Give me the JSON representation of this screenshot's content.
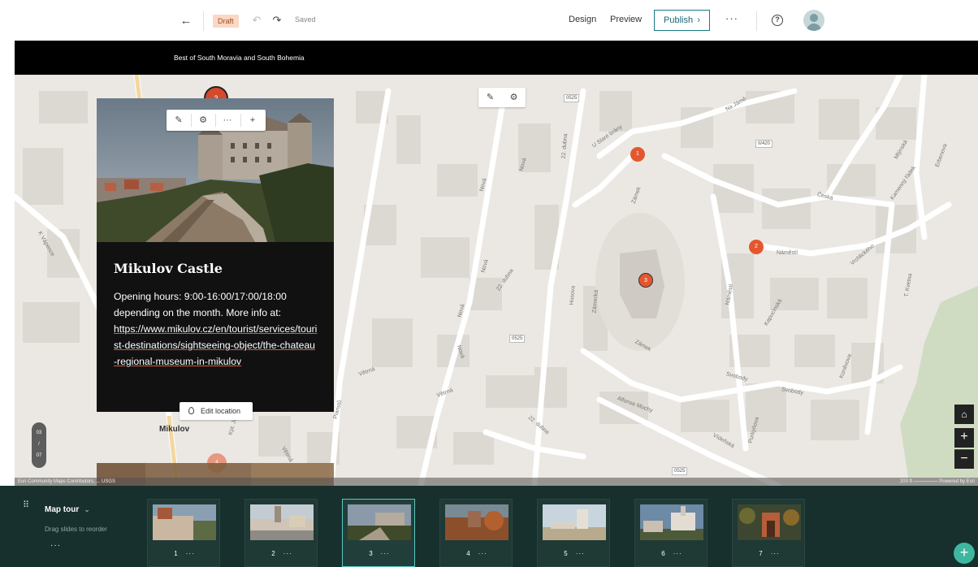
{
  "toolbar": {
    "back_icon": "arrow-left-icon",
    "draft_badge": "Draft",
    "saved_status": "Saved",
    "design_label": "Design",
    "preview_label": "Preview",
    "publish_label": "Publish",
    "more_label": "···",
    "help_icon": "question-circle-icon",
    "avatar_icon": "user-avatar-icon"
  },
  "story": {
    "title": "Best of South Moravia and South Bohemia"
  },
  "map": {
    "street_labels": [
      "Nová",
      "Nová",
      "Nová",
      "Nová",
      "Nová",
      "22. dubna",
      "22. dubna",
      "22. dubna",
      "U Staré brány",
      "Na Jámě",
      "Zámek",
      "Zámek",
      "Zámek",
      "Náměstí",
      "Náměstí",
      "Česká",
      "Vrchlického",
      "Mlýnská",
      "Erbenova",
      "Husova",
      "Zámecká",
      "Kapucínská",
      "Svobody",
      "Svobody",
      "Alfonse Muchy",
      "Vídeňská",
      "Purkyňova",
      "Koněvova",
      "T. Kvetna",
      "Větrná",
      "Větrná",
      "Větrná",
      "Piaristů",
      "K Vápence",
      "Kpt. Jaroše",
      "Kamenný řádek",
      "Brněnská",
      "Komenského",
      "Husova",
      "Ruská",
      "Kozí hrádek"
    ],
    "route_badges": [
      "0525",
      "II/420",
      "0525",
      "0525"
    ],
    "place_label": "Mikulov",
    "markers": [
      {
        "label": "1",
        "active": false
      },
      {
        "label": "2",
        "active": false
      },
      {
        "label": "3",
        "active": false
      },
      {
        "label": "3",
        "active": true
      },
      {
        "label": "4",
        "active": false
      }
    ],
    "map_tools": {
      "edit_icon": "pencil-icon",
      "settings_icon": "gear-icon"
    },
    "home_icon": "home-icon",
    "zoom_in": "+",
    "zoom_out": "−",
    "attribution_left": "Esri Community Maps Contributors, ... USGS",
    "attribution_right": "200 ft ⎯⎯⎯⎯⎯⎯⎯⎯⎯⎯ Powered by Esri",
    "slide_counter": {
      "current": "03",
      "sep": "/",
      "total": "07"
    }
  },
  "card": {
    "toolbar": {
      "edit_icon": "pencil-icon",
      "settings_icon": "gear-icon",
      "more_label": "···",
      "add_label": "+"
    },
    "heading": "Mikulov Castle",
    "body_text": "Opening hours: 9:00-16:00/17:00/18:00 depending on the month. More info at:",
    "link_text": "https://www.mikulov.cz/en/tourist/services/tourist-destinations/sightseeing-object/the-chateau-regional-museum-in-mikulov",
    "edit_location_label": "Edit location"
  },
  "strip": {
    "title": "Map tour",
    "chevron": "⌄",
    "hint": "Drag slides to reorder",
    "more_label": "···",
    "slides": [
      {
        "number": "1",
        "dots": "···"
      },
      {
        "number": "2",
        "dots": "···"
      },
      {
        "number": "3",
        "dots": "···"
      },
      {
        "number": "4",
        "dots": "···"
      },
      {
        "number": "5",
        "dots": "···"
      },
      {
        "number": "6",
        "dots": "···"
      },
      {
        "number": "7",
        "dots": "···"
      }
    ],
    "add_label": "+"
  },
  "colors": {
    "accent": "#e4572e",
    "strip_bg": "#17302d",
    "active_slide_border": "#5cc8c0",
    "publish_border": "#1a7a82",
    "add_button": "#3fb7a0"
  }
}
